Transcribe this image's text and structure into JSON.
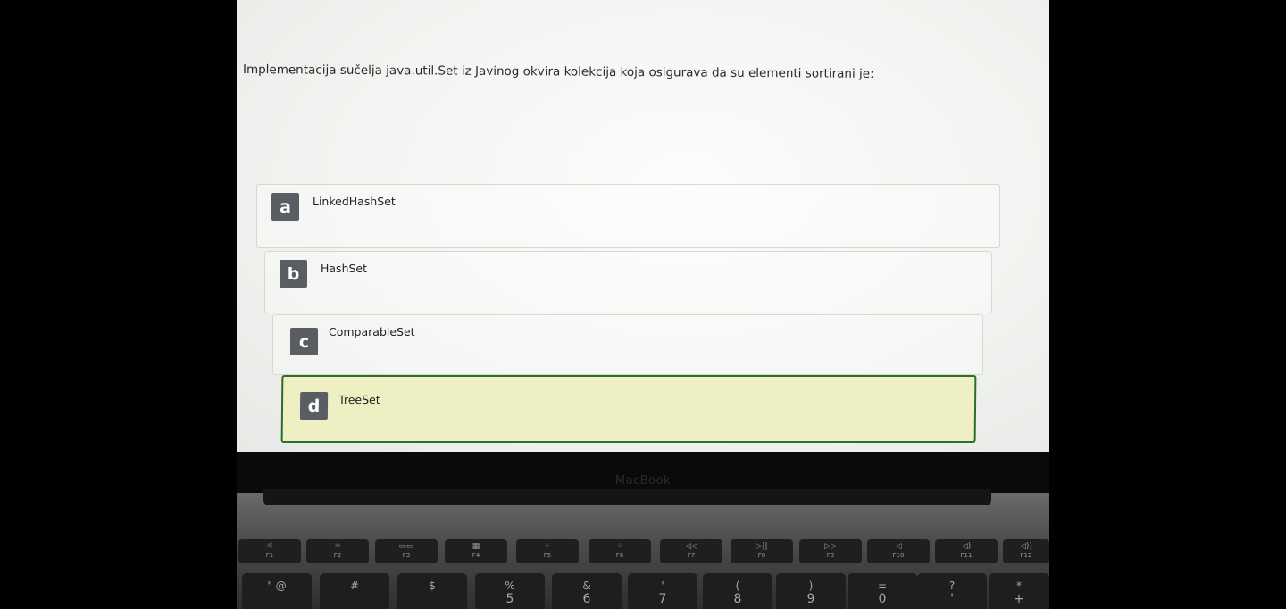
{
  "quiz": {
    "question": "Implementacija sučelja java.util.Set iz Javinog okvira kolekcija koja osigurava da su elementi sortirani je:",
    "options": [
      {
        "letter": "a",
        "label": "LinkedHashSet",
        "selected": false
      },
      {
        "letter": "b",
        "label": "HashSet",
        "selected": false
      },
      {
        "letter": "c",
        "label": "ComparableSet",
        "selected": false
      },
      {
        "letter": "d",
        "label": "TreeSet",
        "selected": true
      }
    ],
    "colors": {
      "selected_bg": "#eef0c4",
      "selected_border": "#2f6d2f",
      "letter_badge": "#5a5e62"
    }
  },
  "laptop": {
    "brand": "MacBook",
    "function_keys": [
      {
        "glyph": "☼",
        "label": "F1"
      },
      {
        "glyph": "☼",
        "label": "F2"
      },
      {
        "glyph": "▭▭",
        "label": "F3"
      },
      {
        "glyph": "▦",
        "label": "F4"
      },
      {
        "glyph": "⁘",
        "label": "F5"
      },
      {
        "glyph": "⁘",
        "label": "F6"
      },
      {
        "glyph": "◁◁",
        "label": "F7"
      },
      {
        "glyph": "▷||",
        "label": "F8"
      },
      {
        "glyph": "▷▷",
        "label": "F9"
      },
      {
        "glyph": "◁",
        "label": "F10"
      },
      {
        "glyph": "◁)",
        "label": "F11"
      },
      {
        "glyph": "◁))",
        "label": "F12"
      }
    ],
    "number_keys": [
      {
        "top": "\" @",
        "bottom": ""
      },
      {
        "top": "#",
        "bottom": ""
      },
      {
        "top": "$",
        "bottom": ""
      },
      {
        "top": "%",
        "bottom": "5"
      },
      {
        "top": "&",
        "bottom": "6"
      },
      {
        "top": "'",
        "bottom": "7"
      },
      {
        "top": "(",
        "bottom": "8"
      },
      {
        "top": ")",
        "bottom": "9"
      },
      {
        "top": "=",
        "bottom": "0"
      },
      {
        "top": "?",
        "bottom": "'"
      },
      {
        "top": "*",
        "bottom": "+"
      }
    ]
  }
}
